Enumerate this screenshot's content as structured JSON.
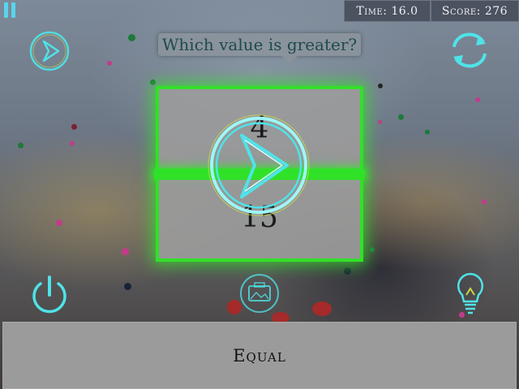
{
  "hud": {
    "time_label": "Time: 16.0",
    "score_label": "Score: 276"
  },
  "question": {
    "text": "Which value is greater?"
  },
  "cards": {
    "top_value": "4",
    "bottom_value": "15"
  },
  "answer": {
    "equal_label": "Equal"
  },
  "icons": {
    "pause": "pause-icon",
    "play": "play-icon",
    "restart": "refresh-icon",
    "power": "power-icon",
    "screenshot": "camera-icon",
    "hint": "lightbulb-icon",
    "center": "play-icon"
  },
  "colors": {
    "neon": "#4fe3e8",
    "highlight": "#32e028",
    "hud_bg": "#4b5260",
    "card_bg": "#9b9b9b"
  }
}
